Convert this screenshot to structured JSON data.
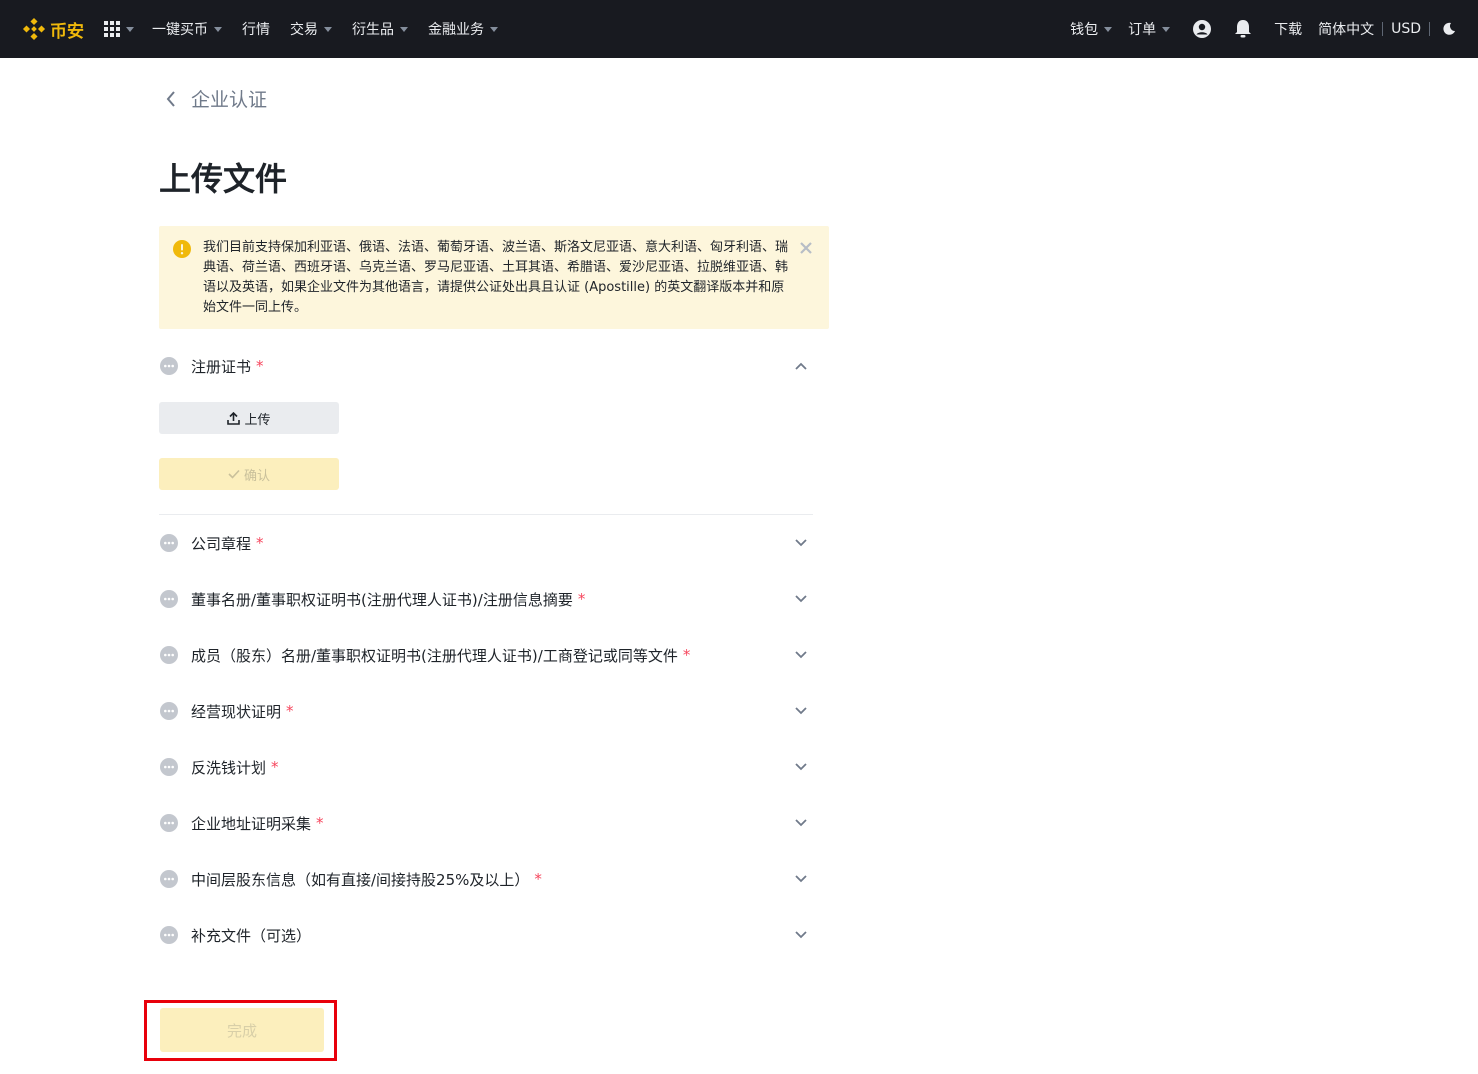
{
  "nav": {
    "brand": "币安",
    "left_items": [
      {
        "label": "一键买币",
        "dropdown": true
      },
      {
        "label": "行情",
        "dropdown": false
      },
      {
        "label": "交易",
        "dropdown": true
      },
      {
        "label": "衍生品",
        "dropdown": true
      },
      {
        "label": "金融业务",
        "dropdown": true
      }
    ],
    "wallet": "钱包",
    "orders": "订单",
    "download": "下载",
    "language": "简体中文",
    "currency": "USD",
    "colors": {
      "bg": "#181a20",
      "brand": "#f0b90b"
    }
  },
  "breadcrumb": {
    "label": "企业认证"
  },
  "page": {
    "title": "上传文件"
  },
  "notice": {
    "text": "我们目前支持保加利亚语、俄语、法语、葡萄牙语、波兰语、斯洛文尼亚语、意大利语、匈牙利语、瑞典语、荷兰语、西班牙语、乌克兰语、罗马尼亚语、土耳其语、希腊语、爱沙尼亚语、拉脱维亚语、韩语以及英语，如果企业文件为其他语言，请提供公证处出具且认证 (Apostille) 的英文翻译版本并和原始文件一同上传。"
  },
  "sections": [
    {
      "label": "注册证书",
      "required": "*",
      "expanded": true
    },
    {
      "label": "公司章程",
      "required": "*",
      "expanded": false
    },
    {
      "label": "董事名册/董事职权证明书(注册代理人证书)/注册信息摘要",
      "required": "*",
      "expanded": false
    },
    {
      "label": "成员（股东）名册/董事职权证明书(注册代理人证书)/工商登记或同等文件",
      "required": "*",
      "expanded": false
    },
    {
      "label": "经营现状证明",
      "required": "*",
      "expanded": false
    },
    {
      "label": "反洗钱计划",
      "required": "*",
      "expanded": false
    },
    {
      "label": "企业地址证明采集",
      "required": "*",
      "expanded": false
    },
    {
      "label": "中间层股东信息（如有直接/间接持股25%及以上）",
      "required": "*",
      "expanded": false
    },
    {
      "label": "补充文件（可选）",
      "required": "",
      "expanded": false
    }
  ],
  "buttons": {
    "upload": "上传",
    "confirm": "确认",
    "finish": "完成"
  }
}
